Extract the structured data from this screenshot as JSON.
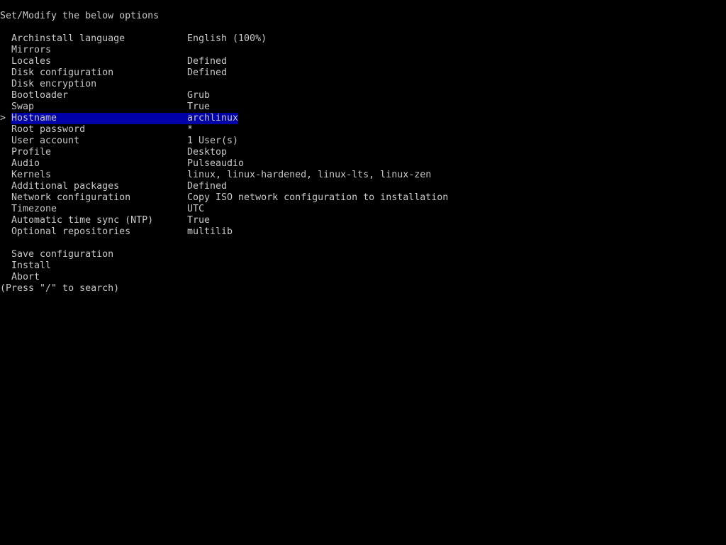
{
  "header": {
    "prompt": "Set/Modify the below options"
  },
  "menu": {
    "cursor_symbol": ">",
    "selected_index": 8,
    "options": [
      {
        "label": "Archinstall language",
        "value": "English (100%)"
      },
      {
        "label": "Mirrors",
        "value": ""
      },
      {
        "label": "Locales",
        "value": "Defined"
      },
      {
        "label": "Disk configuration",
        "value": "Defined"
      },
      {
        "label": "Disk encryption",
        "value": ""
      },
      {
        "label": "Bootloader",
        "value": "Grub"
      },
      {
        "label": "Swap",
        "value": "True"
      },
      {
        "label": "Hostname",
        "value": "archlinux"
      },
      {
        "label": "Hostname",
        "value": "archlinux"
      },
      {
        "label": "Root password",
        "value": "*"
      },
      {
        "label": "User account",
        "value": "1 User(s)"
      },
      {
        "label": "Profile",
        "value": "Desktop"
      },
      {
        "label": "Audio",
        "value": "Pulseaudio"
      },
      {
        "label": "Kernels",
        "value": "linux, linux-hardened, linux-lts, linux-zen"
      },
      {
        "label": "Additional packages",
        "value": "Defined"
      },
      {
        "label": "Network configuration",
        "value": "Copy ISO network configuration to installation"
      },
      {
        "label": "Timezone",
        "value": "UTC"
      },
      {
        "label": "Automatic time sync (NTP)",
        "value": "True"
      },
      {
        "label": "Optional repositories",
        "value": "multilib"
      }
    ],
    "actions": [
      {
        "label": "Save configuration"
      },
      {
        "label": "Install"
      },
      {
        "label": "Abort"
      }
    ]
  },
  "footer": {
    "hint": "(Press \"/\" to search)"
  },
  "colors": {
    "background": "#000000",
    "text": "#c8c8c8",
    "selection": "#0000a8"
  }
}
